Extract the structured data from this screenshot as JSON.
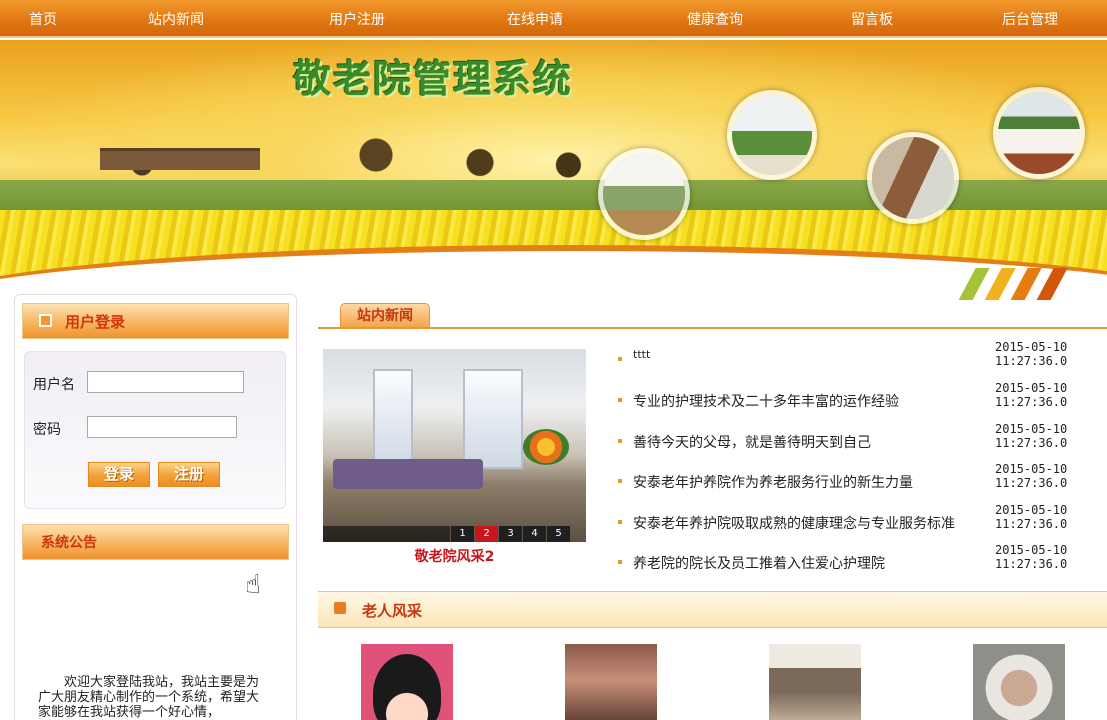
{
  "nav": {
    "items": [
      "首页",
      "站内新闻",
      "用户注册",
      "在线申请",
      "健康查询",
      "留言板",
      "后台管理"
    ]
  },
  "banner": {
    "title": "敬老院管理系统"
  },
  "login": {
    "title": "用户登录",
    "username_label": "用户名",
    "password_label": "密码",
    "username_value": "",
    "password_value": "",
    "login_button": "登录",
    "register_button": "注册"
  },
  "notice": {
    "title": "系统公告",
    "text": "欢迎大家登陆我站，我站主要是为广大朋友精心制作的一个系统，希望大家能够在我站获得一个好心情，"
  },
  "news": {
    "tab": "站内新闻",
    "slide_caption": "敬老院风采2",
    "slide_pages": [
      "1",
      "2",
      "3",
      "4",
      "5"
    ],
    "active_page": "2",
    "items": [
      {
        "title": "tttt",
        "date": "2015-05-10",
        "time": "11:27:36.0"
      },
      {
        "title": "专业的护理技术及二十多年丰富的运作经验",
        "date": "2015-05-10",
        "time": "11:27:36.0"
      },
      {
        "title": "善待今天的父母，就是善待明天到自己",
        "date": "2015-05-10",
        "time": "11:27:36.0"
      },
      {
        "title": "安泰老年护养院作为养老服务行业的新生力量",
        "date": "2015-05-10",
        "time": "11:27:36.0"
      },
      {
        "title": "安泰老年养护院吸取成熟的健康理念与专业服务标准",
        "date": "2015-05-10",
        "time": "11:27:36.0"
      },
      {
        "title": "养老院的院长及员工推着入住爱心护理院",
        "date": "2015-05-10",
        "time": "11:27:36.0"
      }
    ]
  },
  "elders": {
    "title": "老人风采"
  },
  "colors": {
    "accent": "#e07612",
    "heading_red": "#c4380f",
    "caption_red": "#c8161d"
  },
  "icons": {
    "login_head": "square-bullet-icon",
    "elders_head": "square-bullet-icon",
    "cursor": "hand-pointer-icon"
  }
}
